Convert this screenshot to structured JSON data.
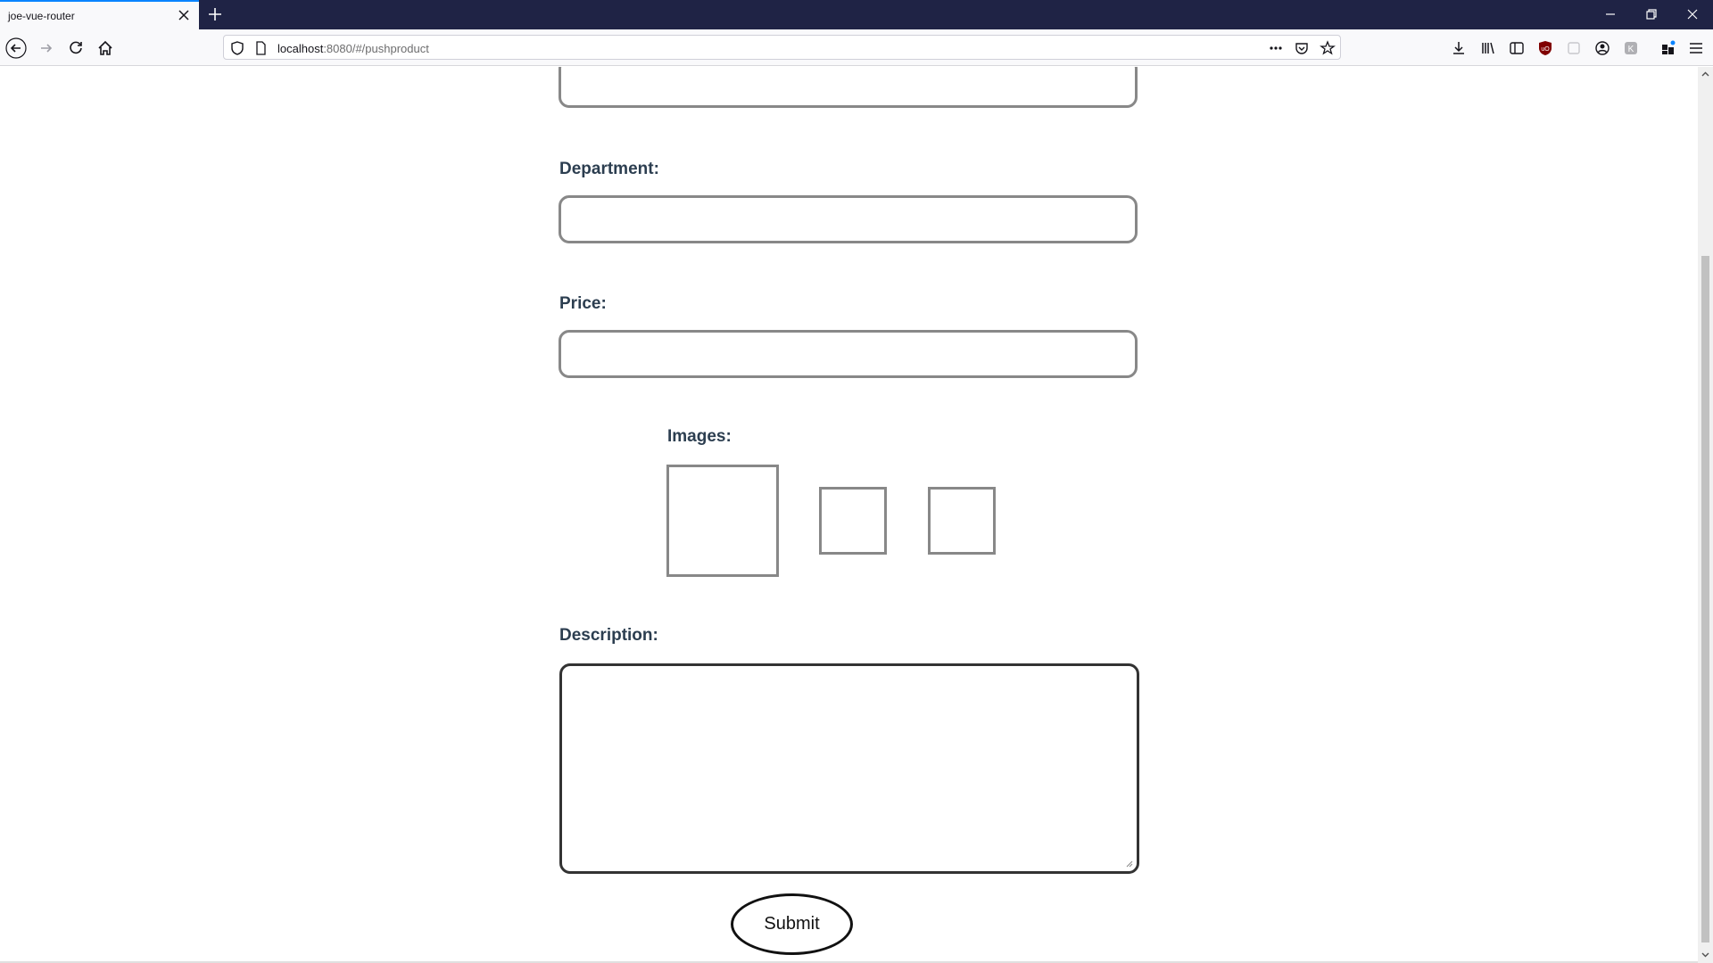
{
  "browser": {
    "tab_title": "joe-vue-router",
    "url_host": "localhost",
    "url_path": ":8080/#/pushproduct"
  },
  "form": {
    "department_label": "Department:",
    "price_label": "Price:",
    "images_label": "Images:",
    "description_label": "Description:",
    "submit_label": "Submit"
  }
}
